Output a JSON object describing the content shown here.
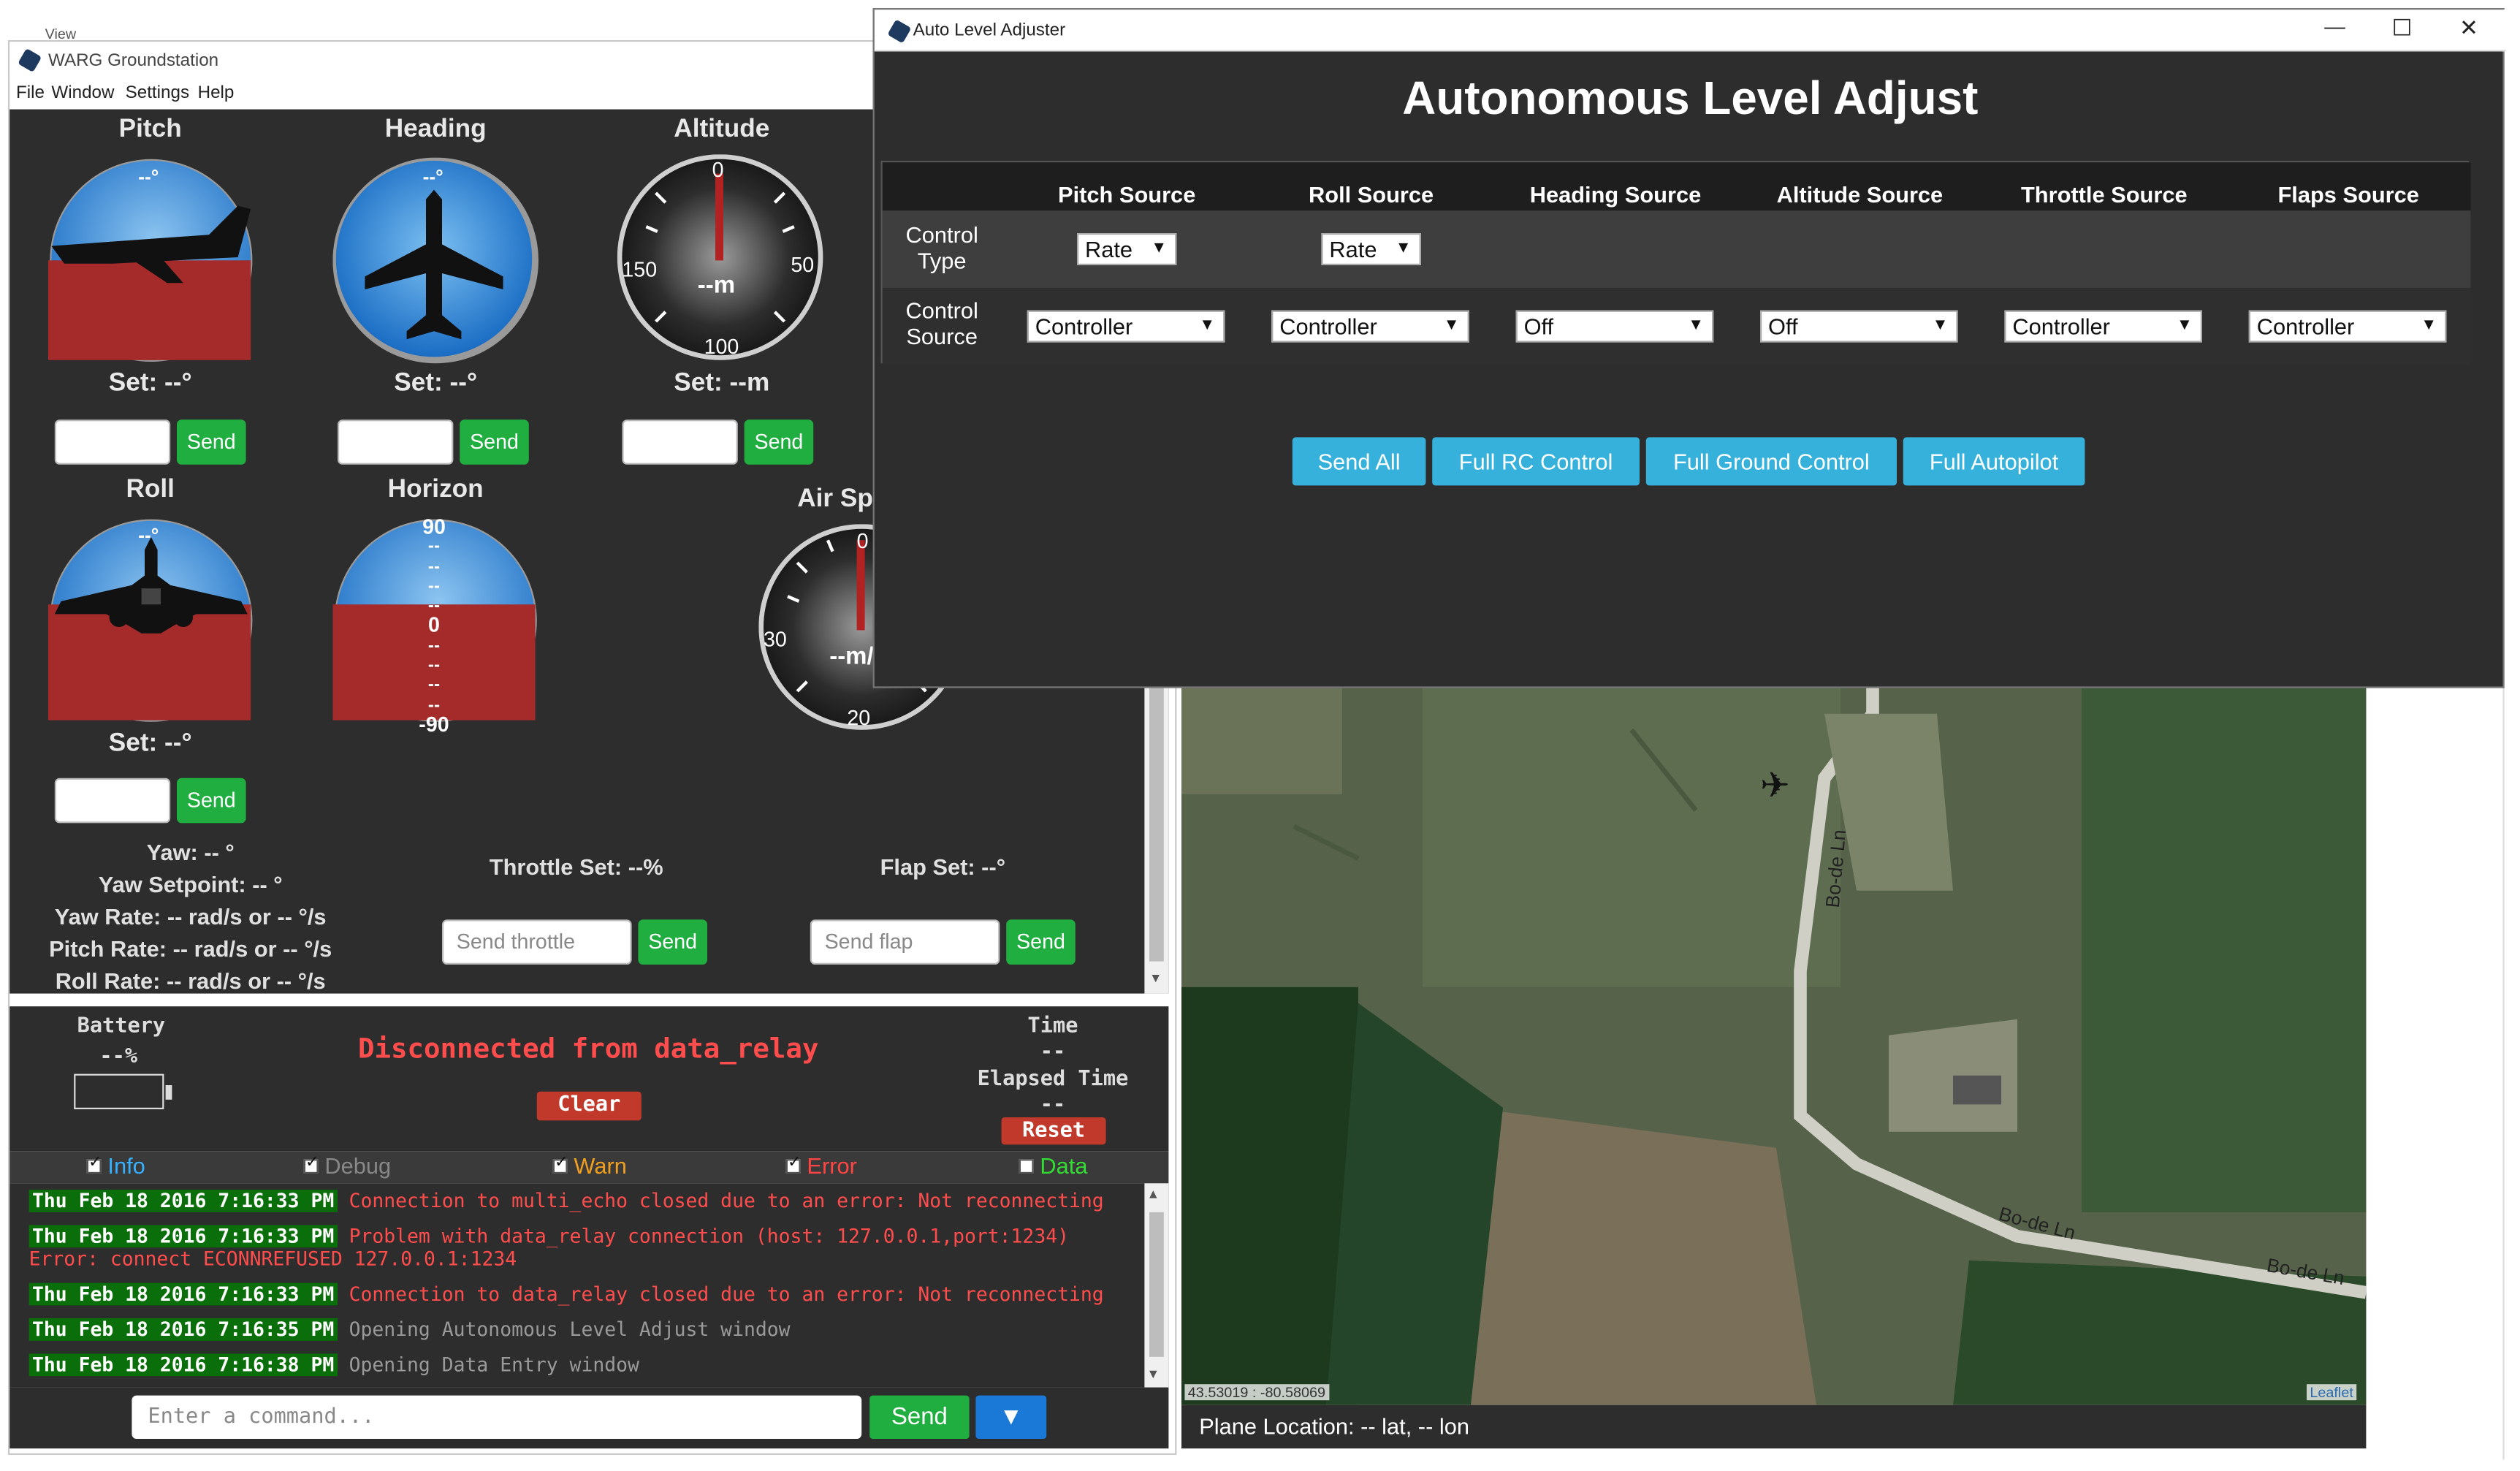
{
  "gs": {
    "title": "WARG Groundstation",
    "menu": [
      "File",
      "Window",
      "Settings",
      "Help"
    ],
    "bg_menu_label": "View",
    "pitch": {
      "title": "Pitch",
      "reading": "--°",
      "set": "Set: --°",
      "send": "Send"
    },
    "heading": {
      "title": "Heading",
      "reading": "--°",
      "set": "Set: --°",
      "send": "Send"
    },
    "altitude": {
      "title": "Altitude",
      "ticks": [
        "0",
        "50",
        "100",
        "150"
      ],
      "center": "--m",
      "set": "Set: --m",
      "send": "Send"
    },
    "roll": {
      "title": "Roll",
      "reading": "--°",
      "set": "Set: --°",
      "send": "Send"
    },
    "horizon": {
      "title": "Horizon",
      "scale": [
        "90",
        "--",
        "--",
        "--",
        "--",
        "0",
        "--",
        "--",
        "--",
        "--",
        "-90"
      ]
    },
    "airspeed": {
      "title": "Air Sp",
      "ticks": [
        "0",
        "30",
        "20"
      ],
      "center": "--m/"
    },
    "rates": [
      "Yaw: -- °",
      "Yaw Setpoint: -- °",
      "Yaw Rate: -- rad/s or -- °/s",
      "Pitch Rate: -- rad/s or -- °/s",
      "Roll Rate: -- rad/s or -- °/s"
    ],
    "throttle": {
      "label": "Throttle Set: --%",
      "placeholder": "Send throttle",
      "send": "Send"
    },
    "flap": {
      "label": "Flap Set: --°",
      "placeholder": "Send flap",
      "send": "Send"
    },
    "status": {
      "battery_label": "Battery",
      "battery_value": "--%",
      "message": "Disconnected from data_relay",
      "clear": "Clear",
      "time_label": "Time",
      "time_value": "--",
      "elapsed_label": "Elapsed Time",
      "elapsed_value": "--",
      "reset": "Reset"
    },
    "filters": [
      {
        "label": "Info",
        "checked": true,
        "color": "#35b1ff"
      },
      {
        "label": "Debug",
        "checked": true,
        "color": "#888888"
      },
      {
        "label": "Warn",
        "checked": true,
        "color": "#f0a020"
      },
      {
        "label": "Error",
        "checked": true,
        "color": "#ff4444"
      },
      {
        "label": "Data",
        "checked": false,
        "color": "#33dd33"
      }
    ],
    "logs": [
      {
        "ts": "Thu Feb 18 2016 7:16:33 PM",
        "msg": "Connection to  multi_echo closed due to an error: Not reconnecting",
        "cls": "err"
      },
      {
        "ts": "Thu Feb 18 2016 7:16:33 PM",
        "msg": "Problem with data_relay connection (host: 127.0.0.1,port:1234)",
        "extra": "Error: connect ECONNREFUSED 127.0.0.1:1234",
        "cls": "err"
      },
      {
        "ts": "Thu Feb 18 2016 7:16:33 PM",
        "msg": "Connection to  data_relay closed due to an error: Not reconnecting",
        "cls": "err"
      },
      {
        "ts": "Thu Feb 18 2016 7:16:35 PM",
        "msg": "Opening Autonomous Level Adjust window",
        "cls": "info"
      },
      {
        "ts": "Thu Feb 18 2016 7:16:38 PM",
        "msg": "Opening Data Entry window",
        "cls": "info"
      }
    ],
    "command": {
      "placeholder": "Enter a command...",
      "send": "Send",
      "dropdown": "▼"
    },
    "map": {
      "coords": "43.53019 : -80.58069",
      "attribution": "Leaflet",
      "road1": "Bo-de Ln",
      "road2": "Bo-de Ln",
      "road3": "Bo-de Ln",
      "location": "Plane Location: -- lat, -- lon"
    }
  },
  "ala": {
    "title": "Auto Level Adjuster",
    "heading": "Autonomous Level Adjust",
    "columns": [
      "Pitch Source",
      "Roll Source",
      "Heading Source",
      "Altitude Source",
      "Throttle Source",
      "Flaps Source"
    ],
    "row1_label": "Control Type",
    "row1": [
      "Rate",
      "Rate"
    ],
    "row2_label": "Control Source",
    "row2": [
      "Controller",
      "Controller",
      "Off",
      "Off",
      "Controller",
      "Controller"
    ],
    "buttons": [
      "Send All",
      "Full RC Control",
      "Full Ground Control",
      "Full Autopilot"
    ],
    "win_controls": {
      "minimize": "—",
      "maximize": "☐",
      "close": "✕"
    }
  },
  "colors": {
    "panel": "#2d2d2d",
    "send_green": "#1fae3f",
    "blue_btn": "#35b1db",
    "sky": "#2d86d6",
    "ground": "#a52a2a",
    "error_red": "#ff4444"
  }
}
